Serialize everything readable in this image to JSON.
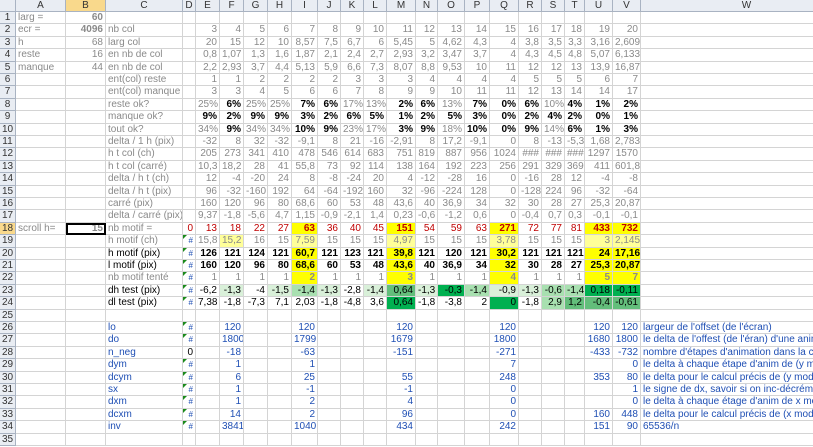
{
  "colors": {
    "yellow": "#ffff00",
    "light_yellow": "#ffff99",
    "green1": "#d9f0d9",
    "green2": "#a8e0b0",
    "green3": "#63be7b",
    "green4": "#00b050",
    "selection": "#f9d98c",
    "text_blue": "#1f4fb4",
    "text_red": "#c00000",
    "text_gray": "#8a8a8a"
  },
  "columns": [
    "A",
    "B",
    "C",
    "D",
    "E",
    "F",
    "G",
    "H",
    "I",
    "J",
    "K",
    "L",
    "M",
    "N",
    "O",
    "P",
    "Q",
    "R",
    "S",
    "T",
    "U",
    "V",
    "W"
  ],
  "row_numbers": [
    "1",
    "2",
    "3",
    "4",
    "5",
    "6",
    "7",
    "8",
    "9",
    "10",
    "11",
    "12",
    "13",
    "14",
    "15",
    "16",
    "17",
    "18",
    "19",
    "20",
    "21",
    "22",
    "23",
    "24",
    "25",
    "26",
    "27",
    "28",
    "29",
    "30",
    "31",
    "32",
    "33",
    "34",
    "35"
  ],
  "rows": [
    {
      "A": "larg =",
      "B": "60",
      "Bs": "b"
    },
    {
      "A": "ecr =",
      "B": "4096",
      "Bs": "b",
      "C": "nb col",
      "E": "3",
      "F": "4",
      "G": "5",
      "H": "6",
      "I": "7",
      "J": "8",
      "K": "9",
      "L": "10",
      "M": "11",
      "N": "12",
      "O": "13",
      "P": "14",
      "Q": "15",
      "R": "16",
      "S": "17",
      "T": "18",
      "U": "19",
      "V": "20",
      "gray": true
    },
    {
      "A": "h",
      "B": "68",
      "C": "larg col",
      "E": "20",
      "F": "15",
      "G": "12",
      "H": "10",
      "I": "8,57",
      "J": "7,5",
      "K": "6,7",
      "L": "6",
      "M": "5,45",
      "N": "5",
      "O": "4,62",
      "P": "4,3",
      "Q": "4",
      "R": "3,8",
      "S": "3,5",
      "T": "3,3",
      "U": "3,16",
      "V": "2,609",
      "gray": true
    },
    {
      "A": "reste",
      "B": "16",
      "C": "en nb de col",
      "E": "0,8",
      "F": "1,07",
      "G": "1,3",
      "H": "1,6",
      "I": "1,87",
      "J": "2,1",
      "K": "2,4",
      "L": "2,7",
      "M": "2,93",
      "N": "3,2",
      "O": "3,47",
      "P": "3,7",
      "Q": "4",
      "R": "4,3",
      "S": "4,5",
      "T": "4,8",
      "U": "5,07",
      "V": "6,133",
      "gray": true
    },
    {
      "A": "manque",
      "B": "44",
      "C": "en nb de col",
      "E": "2,2",
      "F": "2,93",
      "G": "3,7",
      "H": "4,4",
      "I": "5,13",
      "J": "5,9",
      "K": "6,6",
      "L": "7,3",
      "M": "8,07",
      "N": "8,8",
      "O": "9,53",
      "P": "10",
      "Q": "11",
      "R": "12",
      "S": "12",
      "T": "13",
      "U": "13,9",
      "V": "16,87",
      "gray": true
    },
    {
      "C": "ent(col) reste",
      "E": "1",
      "F": "1",
      "G": "2",
      "H": "2",
      "I": "2",
      "J": "2",
      "K": "3",
      "L": "3",
      "M": "3",
      "N": "4",
      "O": "4",
      "P": "4",
      "Q": "4",
      "R": "5",
      "S": "5",
      "T": "5",
      "U": "6",
      "V": "7",
      "gray": true
    },
    {
      "C": "ent(col) manque",
      "E": "3",
      "F": "3",
      "G": "4",
      "H": "5",
      "I": "6",
      "J": "6",
      "K": "7",
      "L": "8",
      "M": "9",
      "N": "9",
      "O": "10",
      "P": "11",
      "Q": "11",
      "R": "12",
      "S": "13",
      "T": "14",
      "U": "14",
      "V": "17",
      "gray": true
    },
    {
      "C": "reste ok?",
      "E": "25%",
      "F": "6%",
      "G": "25%",
      "H": "25%",
      "I": "7%",
      "J": "6%",
      "K": "17%",
      "L": "13%",
      "M": "2%",
      "N": "6%",
      "O": "13%",
      "P": "7%",
      "Q": "0%",
      "R": "6%",
      "S": "10%",
      "T": "4%",
      "U": "1%",
      "V": "2%",
      "gray": true,
      "boldcols": [
        "F",
        "I",
        "J",
        "M",
        "N",
        "P",
        "Q",
        "R",
        "T",
        "U",
        "V"
      ]
    },
    {
      "C": "manque ok?",
      "E": "9%",
      "F": "2%",
      "G": "9%",
      "H": "9%",
      "I": "3%",
      "J": "2%",
      "K": "6%",
      "L": "5%",
      "M": "1%",
      "N": "2%",
      "O": "5%",
      "P": "3%",
      "Q": "0%",
      "R": "2%",
      "S": "4%",
      "T": "2%",
      "U": "0%",
      "V": "1%",
      "gray": true,
      "boldcols": [
        "E",
        "F",
        "G",
        "H",
        "I",
        "J",
        "K",
        "L",
        "M",
        "N",
        "O",
        "P",
        "Q",
        "R",
        "S",
        "T",
        "U",
        "V"
      ]
    },
    {
      "C": "tout ok?",
      "E": "34%",
      "F": "9%",
      "G": "34%",
      "H": "34%",
      "I": "10%",
      "J": "9%",
      "K": "23%",
      "L": "17%",
      "M": "3%",
      "N": "9%",
      "O": "18%",
      "P": "10%",
      "Q": "0%",
      "R": "9%",
      "S": "14%",
      "T": "6%",
      "U": "1%",
      "V": "3%",
      "gray": true,
      "boldcols": [
        "F",
        "I",
        "J",
        "M",
        "N",
        "P",
        "Q",
        "R",
        "T",
        "U",
        "V"
      ]
    },
    {
      "C": "delta / 1 h (pix)",
      "E": "-32",
      "F": "8",
      "G": "32",
      "H": "-32",
      "I": "-9,1",
      "J": "8",
      "K": "21",
      "L": "-16",
      "M": "-2,91",
      "N": "8",
      "O": "17,2",
      "P": "-9,1",
      "Q": "0",
      "R": "8",
      "S": "-13",
      "T": "-5,3",
      "U": "1,68",
      "V": "2,783",
      "gray": true
    },
    {
      "C": "h t col (ch)",
      "E": "205",
      "F": "273",
      "G": "341",
      "H": "410",
      "I": "478",
      "J": "546",
      "K": "614",
      "L": "683",
      "M": "751",
      "N": "819",
      "O": "887",
      "P": "956",
      "Q": "1024",
      "R": "###",
      "S": "###",
      "T": "###",
      "U": "1297",
      "V": "1570",
      "gray": true
    },
    {
      "C": "h t col (carré)",
      "E": "10,3",
      "F": "18,2",
      "G": "28",
      "H": "41",
      "I": "55,8",
      "J": "73",
      "K": "92",
      "L": "114",
      "M": "138",
      "N": "164",
      "O": "192",
      "P": "223",
      "Q": "256",
      "R": "291",
      "S": "329",
      "T": "369",
      "U": "411",
      "V": "601,8",
      "gray": true
    },
    {
      "C": "delta / h t (ch)",
      "E": "12",
      "F": "-4",
      "G": "-20",
      "H": "24",
      "I": "8",
      "J": "-8",
      "K": "-24",
      "L": "20",
      "M": "4",
      "N": "-12",
      "O": "-28",
      "P": "16",
      "Q": "0",
      "R": "-16",
      "S": "28",
      "T": "12",
      "U": "-4",
      "V": "-8",
      "gray": true
    },
    {
      "C": "delta / h t (pix)",
      "E": "96",
      "F": "-32",
      "G": "-160",
      "H": "192",
      "I": "64",
      "J": "-64",
      "K": "-192",
      "L": "160",
      "M": "32",
      "N": "-96",
      "O": "-224",
      "P": "128",
      "Q": "0",
      "R": "-128",
      "S": "224",
      "T": "96",
      "U": "-32",
      "V": "-64",
      "gray": true
    },
    {
      "C": "carré (pix)",
      "E": "160",
      "F": "120",
      "G": "96",
      "H": "80",
      "I": "68,6",
      "J": "60",
      "K": "53",
      "L": "48",
      "M": "43,6",
      "N": "40",
      "O": "36,9",
      "P": "34",
      "Q": "32",
      "R": "30",
      "S": "28",
      "T": "27",
      "U": "25,3",
      "V": "20,87",
      "gray": true
    },
    {
      "C": "delta / carré (pix)",
      "E": "9,37",
      "F": "-1,8",
      "G": "-5,6",
      "H": "4,7",
      "I": "1,15",
      "J": "-0,9",
      "K": "-2,1",
      "L": "1,4",
      "M": "0,23",
      "N": "-0,6",
      "O": "-1,2",
      "P": "0,6",
      "Q": "0",
      "R": "-0,4",
      "S": "0,7",
      "T": "0,3",
      "U": "-0,1",
      "V": "-0,1",
      "gray": true
    },
    {
      "A": "scroll h=",
      "B": "15",
      "C": "nb motif =",
      "E": "13",
      "F": "18",
      "G": "22",
      "H": "27",
      "I": "63",
      "J": "36",
      "K": "40",
      "L": "45",
      "M": "151",
      "N": "54",
      "O": "59",
      "P": "63",
      "Q": "271",
      "R": "72",
      "S": "77",
      "T": "81",
      "U": "433",
      "V": "732",
      "D": "0",
      "red": true
    },
    {
      "C": "h motif (ch)",
      "D": "#",
      "E": "15,8",
      "F": "15,2",
      "G": "16",
      "H": "15",
      "I": "7,59",
      "J": "15",
      "K": "15",
      "L": "15",
      "M": "4,97",
      "N": "15",
      "O": "15",
      "P": "15",
      "Q": "3,78",
      "R": "15",
      "S": "15",
      "T": "15",
      "U": "3",
      "V": "2,145",
      "gray": true
    },
    {
      "C": "h motif (pix)",
      "D": "#",
      "E": "126",
      "F": "121",
      "G": "124",
      "H": "121",
      "I": "60,7",
      "J": "121",
      "K": "123",
      "L": "121",
      "M": "39,8",
      "N": "121",
      "O": "120",
      "P": "121",
      "Q": "30,2",
      "R": "121",
      "S": "121",
      "T": "121",
      "U": "24",
      "V": "17,16",
      "bold": true
    },
    {
      "C": "l motif (pix)",
      "D": "#",
      "E": "160",
      "F": "120",
      "G": "96",
      "H": "80",
      "I": "68,6",
      "J": "60",
      "K": "53",
      "L": "48",
      "M": "43,6",
      "N": "40",
      "O": "36,9",
      "P": "34",
      "Q": "32",
      "R": "30",
      "S": "28",
      "T": "27",
      "U": "25,3",
      "V": "20,87",
      "bold": true
    },
    {
      "C": "nb motif tenté",
      "D": "#",
      "E": "1",
      "F": "1",
      "G": "1",
      "H": "1",
      "I": "2",
      "J": "1",
      "K": "1",
      "L": "1",
      "M": "3",
      "N": "1",
      "O": "1",
      "P": "1",
      "Q": "4",
      "R": "1",
      "S": "1",
      "T": "1",
      "U": "5",
      "V": "7",
      "gray": true
    },
    {
      "C": "dh test (pix)",
      "D": "#",
      "E": "-6,2",
      "F": "-1,3",
      "G": "-4",
      "H": "-1,5",
      "I": "-1,4",
      "J": "-1,3",
      "K": "-2,8",
      "L": "-1,4",
      "M": "0,64",
      "N": "-1,3",
      "O": "-0,3",
      "P": "-1,4",
      "Q": "-0,9",
      "R": "-1,3",
      "S": "-0,6",
      "T": "-1,4",
      "U": "0,18",
      "V": "-0,11"
    },
    {
      "C": "dl test (pix)",
      "D": "#",
      "E": "7,38",
      "F": "-1,8",
      "G": "-7,3",
      "H": "7,1",
      "I": "2,03",
      "J": "-1,8",
      "K": "-4,8",
      "L": "3,6",
      "M": "0,64",
      "N": "-1,8",
      "O": "-3,8",
      "P": "2",
      "Q": "0",
      "R": "-1,8",
      "S": "2,9",
      "T": "1,2",
      "U": "-0,4",
      "V": "-0,61"
    },
    {},
    {
      "C": "lo",
      "D": "#",
      "F": "120",
      "I": "120",
      "M": "120",
      "Q": "120",
      "U": "120",
      "V": "120",
      "W": "largeur de l'offset (de l'écran)",
      "blue": true
    },
    {
      "C": "do",
      "D": "#",
      "F": "1800",
      "I": "1799",
      "M": "1679",
      "Q": "1800",
      "U": "1680",
      "V": "1800",
      "W": "le delta de l'offest (de l'éran) d'une anim à l'autre",
      "blue": true
    },
    {
      "C": "n_neg",
      "D": "0",
      "F": "-18",
      "I": "-63",
      "M": "-151",
      "Q": "-271",
      "U": "-433",
      "V": "-732",
      "W": "nombre d'étapes d'animation dans la colonne",
      "blue": true
    },
    {
      "C": "dym",
      "D": "#",
      "F": "1",
      "I": "1",
      "M": "",
      "Q": "7",
      "U": "",
      "V": "0",
      "W": "le delta à chaque étape d'anim de (y modulo 8)",
      "blue": true
    },
    {
      "C": "dcym",
      "D": "#",
      "F": "6",
      "I": "25",
      "M": "55",
      "Q": "248",
      "U": "353",
      "V": "80",
      "W": "le delta pour le calcul précis de (y modulo 8)",
      "blue": true
    },
    {
      "C": "sx",
      "D": "#",
      "F": "1",
      "I": "-1",
      "M": "-1",
      "Q": "0",
      "U": "",
      "V": "1",
      "W": "le signe de dx, savoir si on inc-décrémente",
      "blue": true
    },
    {
      "C": "dxm",
      "D": "#",
      "F": "1",
      "I": "2",
      "M": "4",
      "Q": "0",
      "U": "",
      "V": "0",
      "W": "le delta à chaque étage d'anim de x modulo 8)",
      "blue": true
    },
    {
      "C": "dcxm",
      "D": "#",
      "F": "14",
      "I": "2",
      "M": "96",
      "Q": "0",
      "U": "160",
      "V": "448",
      "W": "le delta pour le calcul précis de (x modulo 8)",
      "blue": true
    },
    {
      "C": "inv",
      "D": "#",
      "F": "3841",
      "I": "1040",
      "M": "434",
      "Q": "242",
      "U": "151",
      "V": "90",
      "W": "65536/n",
      "blue": true
    },
    {}
  ]
}
